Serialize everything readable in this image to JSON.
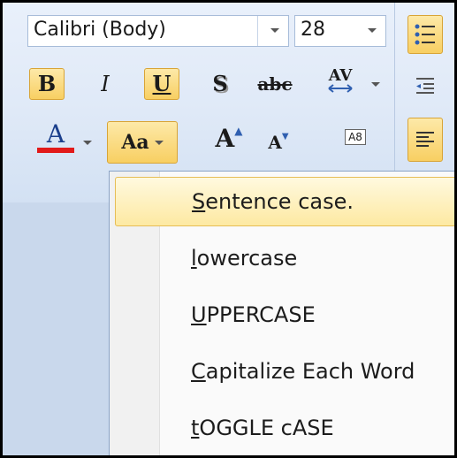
{
  "font": {
    "family_value": "Calibri (Body)",
    "size_value": "28"
  },
  "toolbar": {
    "bold": "B",
    "italic": "I",
    "underline": "U",
    "shadow": "S",
    "strikethrough": "abc",
    "char_spacing": "AV",
    "font_color_letter": "A",
    "change_case": "Aa",
    "grow_font": "A",
    "shrink_font": "A",
    "clear_format": "A8"
  },
  "colors": {
    "font_color_underline": "#e21a1a",
    "active_fill": "#f8cf62",
    "menu_border": "#8aa3c6"
  },
  "change_case_menu": {
    "items": [
      {
        "label_first": "S",
        "label_rest": "entence case.",
        "hover": true
      },
      {
        "label_first": "l",
        "label_rest": "owercase",
        "hover": false
      },
      {
        "label_first": "U",
        "label_rest": "PPERCASE",
        "hover": false
      },
      {
        "label_first": "C",
        "label_rest": "apitalize Each Word",
        "hover": false
      },
      {
        "label_first": "t",
        "label_rest": "OGGLE cASE",
        "hover": false
      }
    ]
  }
}
